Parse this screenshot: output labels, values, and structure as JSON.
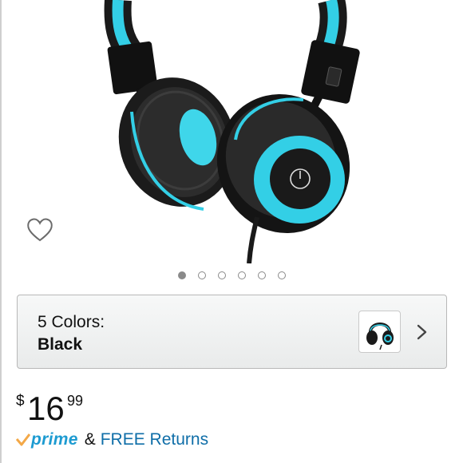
{
  "product": {
    "image_subject": "headphones-black-blue",
    "gallery_count": 6,
    "gallery_active_index": 0
  },
  "variant": {
    "count_label": "5 Colors:",
    "selected": "Black"
  },
  "price": {
    "symbol": "$",
    "whole": "16",
    "fraction": "99"
  },
  "shipping": {
    "prime_label": "prime",
    "connector": "&",
    "returns_label": "FREE Returns"
  },
  "colors": {
    "prime_check": "#f3a847",
    "prime_text": "#1d9bd1",
    "link": "#0f6ea8",
    "accent_cyan": "#2fd2e8"
  },
  "icons": {
    "wishlist": "heart-outline-icon",
    "chevron": "chevron-right-icon"
  }
}
